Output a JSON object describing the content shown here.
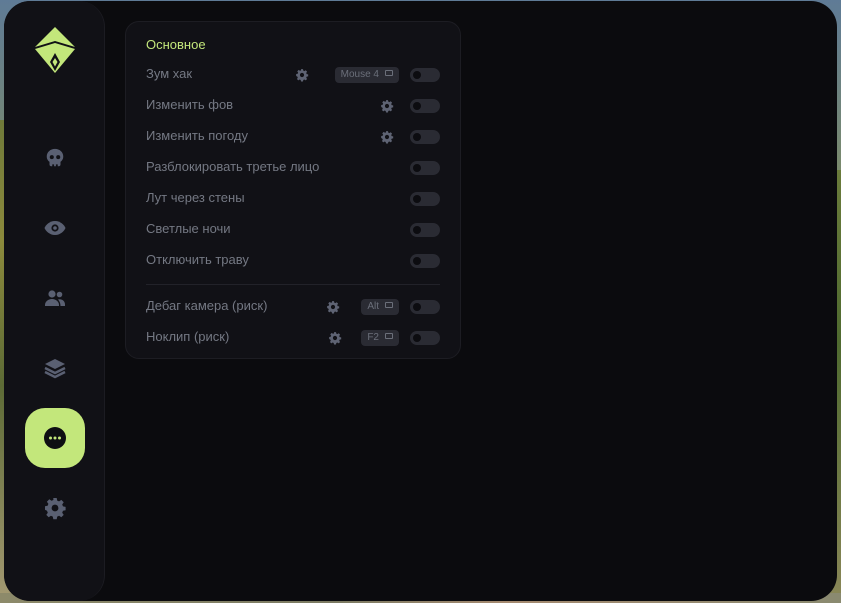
{
  "colors": {
    "accent": "#c3e77b",
    "window_bg": "#0b0b0e",
    "panel_bg": "#111116",
    "label": "#747883",
    "toggle_off": "#2a2b33"
  },
  "sidebar": {
    "logo": "diamond-logo-icon",
    "items": [
      {
        "icon": "skull-icon",
        "active": false
      },
      {
        "icon": "eye-icon",
        "active": false
      },
      {
        "icon": "users-icon",
        "active": false
      },
      {
        "icon": "layers-icon",
        "active": false
      },
      {
        "icon": "more-dots-icon",
        "active": true
      },
      {
        "icon": "gear-icon",
        "active": false
      }
    ]
  },
  "panel": {
    "title": "Основное",
    "rows": [
      {
        "label": "Зум хак",
        "settings": true,
        "keybind": "Mouse 4",
        "enabled": false
      },
      {
        "label": "Изменить фов",
        "settings": true,
        "keybind": null,
        "enabled": false
      },
      {
        "label": "Изменить погоду",
        "settings": true,
        "keybind": null,
        "enabled": false
      },
      {
        "label": "Разблокировать третье лицо",
        "settings": false,
        "keybind": null,
        "enabled": false
      },
      {
        "label": "Лут через стены",
        "settings": false,
        "keybind": null,
        "enabled": false
      },
      {
        "label": "Светлые ночи",
        "settings": false,
        "keybind": null,
        "enabled": false
      },
      {
        "label": "Отключить траву",
        "settings": false,
        "keybind": null,
        "enabled": false
      },
      {
        "label": "Дебаг камера (риск)",
        "settings": true,
        "keybind": "Alt",
        "enabled": false
      },
      {
        "label": "Ноклип (риск)",
        "settings": true,
        "keybind": "F2",
        "enabled": false
      }
    ]
  }
}
